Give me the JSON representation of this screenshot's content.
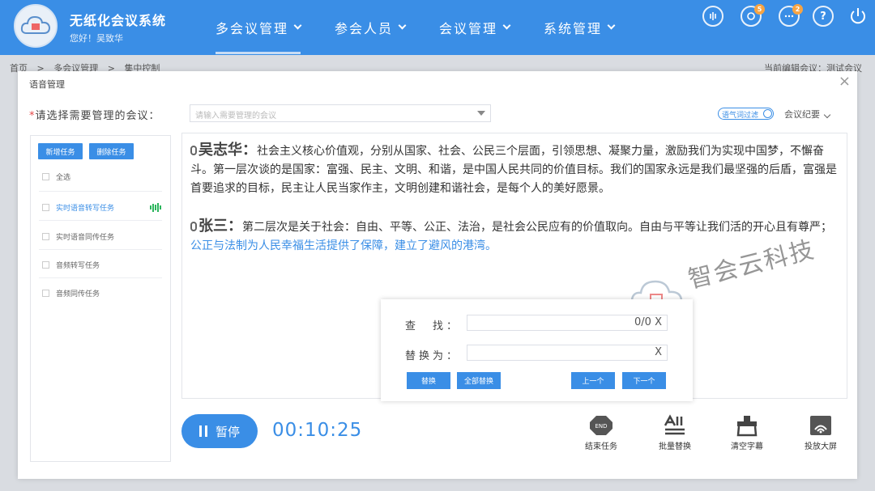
{
  "header": {
    "system_title": "无纸化会议系统",
    "greeting": "您好！吴致华",
    "nav": [
      {
        "label": "多会议管理"
      },
      {
        "label": "参会人员"
      },
      {
        "label": "会议管理"
      },
      {
        "label": "系统管理"
      }
    ],
    "badges": {
      "notifications": "5",
      "messages": "2"
    },
    "help_glyph": "?"
  },
  "breadcrumb": {
    "items": [
      "首页",
      ">",
      "多会议管理",
      ">",
      "集中控制"
    ],
    "current_meeting": "当前编辑会议：测试会议"
  },
  "modal": {
    "title": "语音管理",
    "close": "×",
    "select_label_req": "*",
    "select_label": "请选择需要管理的会议：",
    "select_placeholder": "请输入需要管理的会议",
    "filter_label": "语气词过滤",
    "minutes_label": "会议纪要"
  },
  "tasks": {
    "add_button": "新增任务",
    "delete_button": "删除任务",
    "select_all": "全选",
    "items": [
      {
        "label": "实时语音转写任务",
        "active": true
      },
      {
        "label": "实时语音同传任务",
        "active": false
      },
      {
        "label": "音频转写任务",
        "active": false
      },
      {
        "label": "音频同传任务",
        "active": false
      }
    ]
  },
  "transcript": [
    {
      "speaker": "吴志华：",
      "text": "社会主义核心价值观，分别从国家、社会、公民三个层面，引领思想、凝聚力量，激励我们为实现中国梦，不懈奋斗。第一层次谈的是国家：富强、民主、文明、和谐，是中国人民共同的价值目标。我们的国家永远是我们最坚强的后盾，富强是首要追求的目标，民主让人民当家作主，文明创建和谐社会，是每个人的美好愿景。",
      "highlight": ""
    },
    {
      "speaker": "张三：",
      "text": "第二层次是关于社会：自由、平等、公正、法治，是社会公民应有的价值取向。自由与平等让我们活的开心且有尊严；",
      "highlight": "公正与法制为人民幸福生活提供了保障，建立了避风的港湾。"
    }
  ],
  "watermark": "智会云科技",
  "find_replace": {
    "find_label": "查　找：",
    "find_count": "0/0",
    "clear": "X",
    "replace_label": "替换为：",
    "replace_button": "替换",
    "replace_all_button": "全部替换",
    "prev_button": "上一个",
    "next_button": "下一个"
  },
  "controls": {
    "pause_label": "暂停",
    "timer": "00:10:25",
    "end_badge": "END",
    "tools": [
      {
        "label": "结束任务",
        "icon": "end-task-icon"
      },
      {
        "label": "批量替换",
        "icon": "batch-replace-icon"
      },
      {
        "label": "清空字幕",
        "icon": "clear-subtitles-icon"
      },
      {
        "label": "投放大屏",
        "icon": "cast-screen-icon"
      }
    ]
  },
  "colors": {
    "primary": "#3a8ee6",
    "active_wave": "#2bb55c",
    "required": "#e54848"
  }
}
